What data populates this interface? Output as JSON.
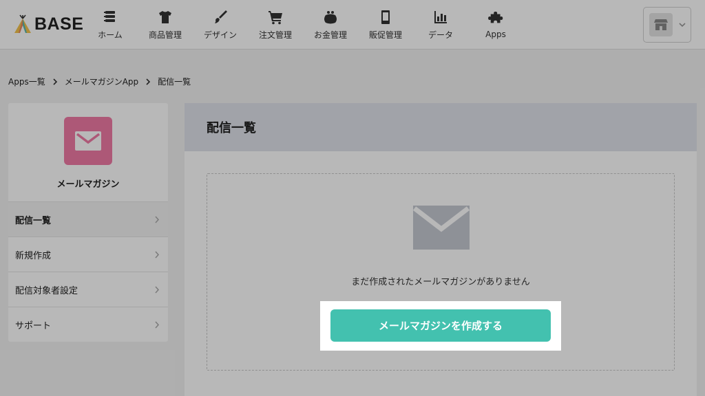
{
  "header": {
    "logo_text": "BASE",
    "nav": [
      {
        "label": "ホーム",
        "icon": "home-icon"
      },
      {
        "label": "商品管理",
        "icon": "tshirt-icon"
      },
      {
        "label": "デザイン",
        "icon": "brush-icon"
      },
      {
        "label": "注文管理",
        "icon": "cart-icon"
      },
      {
        "label": "お金管理",
        "icon": "purse-icon"
      },
      {
        "label": "販促管理",
        "icon": "smartphone-icon"
      },
      {
        "label": "データ",
        "icon": "bar-chart-icon"
      },
      {
        "label": "Apps",
        "icon": "puzzle-icon"
      }
    ],
    "shop_icon": "shop-icon"
  },
  "breadcrumb": {
    "items": [
      "Apps一覧",
      "メールマガジンApp",
      "配信一覧"
    ]
  },
  "sidebar": {
    "app_name": "メールマガジン",
    "app_icon": "mail-icon",
    "items": [
      {
        "label": "配信一覧",
        "active": true
      },
      {
        "label": "新規作成",
        "active": false
      },
      {
        "label": "配信対象者設定",
        "active": false
      },
      {
        "label": "サポート",
        "active": false
      }
    ]
  },
  "main": {
    "title": "配信一覧",
    "empty_message": "まだ作成されたメールマガジンがありません",
    "create_button_label": "メールマガジンを作成する"
  },
  "colors": {
    "accent": "#43c1af",
    "app_icon_bg": "#f07aa6",
    "header_band": "#dfe2ea"
  }
}
